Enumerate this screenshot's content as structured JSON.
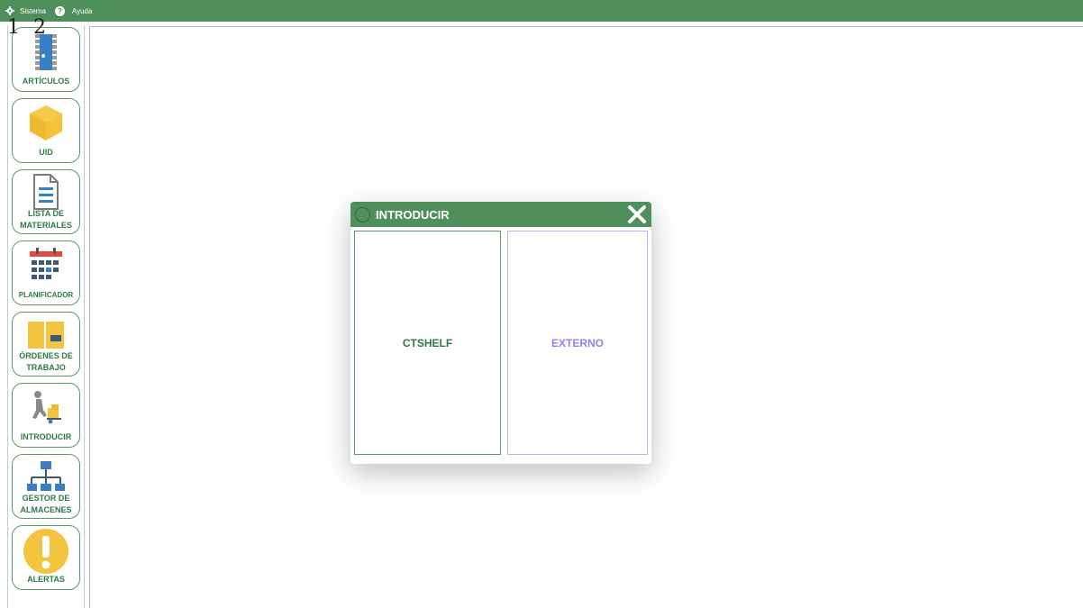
{
  "menubar": {
    "items": [
      {
        "label": "Sistema",
        "icon": "gear-icon"
      },
      {
        "label": "Ayuda",
        "icon": "help-icon"
      }
    ]
  },
  "overlay_numbers": "1 2",
  "sidebar": {
    "items": [
      {
        "label": "ARTÍCULOS",
        "icon": "chip-icon"
      },
      {
        "label": "UID",
        "icon": "cube-icon"
      },
      {
        "label": "LISTA DE MATERIALES",
        "icon": "document-icon"
      },
      {
        "label": "PLANIFICADOR",
        "icon": "calendar-icon"
      },
      {
        "label": "ÓRDENES DE TRABAJO",
        "icon": "work-order-icon"
      },
      {
        "label": "INTRODUCIR",
        "icon": "hand-truck-icon"
      },
      {
        "label": "GESTOR DE ALMACENES",
        "icon": "hierarchy-icon"
      },
      {
        "label": "ALERTAS",
        "icon": "alert-icon"
      }
    ]
  },
  "dialog": {
    "title": "INTRODUCIR",
    "options": [
      {
        "label": "CTSHELF"
      },
      {
        "label": "EXTERNO"
      }
    ]
  },
  "colors": {
    "brand_green": "#4f8f5c",
    "label_green": "#2e7a44",
    "externo_purple": "#8c86ec"
  }
}
